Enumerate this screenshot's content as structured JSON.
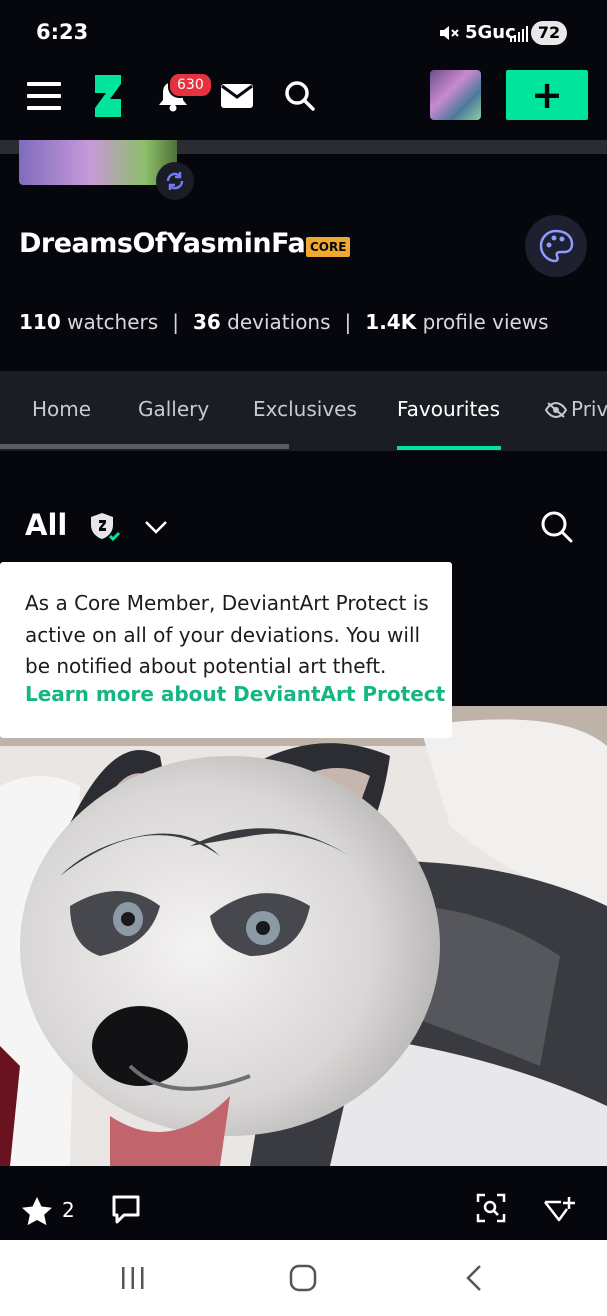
{
  "status_bar": {
    "time": "6:23",
    "network": "5Guc",
    "battery": "72"
  },
  "top_nav": {
    "notification_count": "630",
    "icons": [
      "menu-icon",
      "deviantart-logo-icon",
      "bell-icon",
      "mail-icon",
      "search-icon",
      "avatar",
      "plus-icon"
    ]
  },
  "profile": {
    "username": "DreamsOfYasminFan",
    "badge": "CORE",
    "stats": {
      "watchers_count": "110",
      "watchers_label": "watchers",
      "deviations_count": "36",
      "deviations_label": "deviations",
      "views_count": "1.4K",
      "views_label": "profile views",
      "separator": "|"
    }
  },
  "tabs": [
    {
      "label": "Home"
    },
    {
      "label": "Gallery"
    },
    {
      "label": "Exclusives"
    },
    {
      "label": "Favourites",
      "active": true
    },
    {
      "label": "Priv"
    }
  ],
  "filter": {
    "label": "All"
  },
  "tooltip": {
    "text": "As a Core Member, DeviantArt Protect is active on all of your deviations. You will be notified about potential art theft.",
    "link": "Learn more about DeviantArt Protect"
  },
  "deviation": {
    "favourites": "2"
  },
  "colors": {
    "accent": "#00e59b",
    "badge_red": "#e8313f",
    "core_badge": "#f0a830",
    "link_green": "#16b584"
  }
}
